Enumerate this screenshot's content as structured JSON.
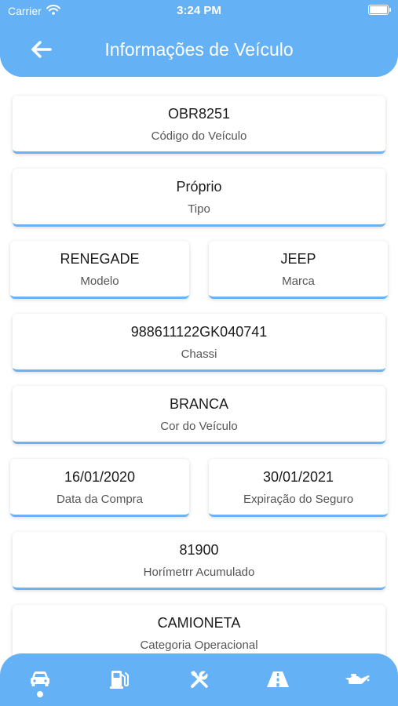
{
  "status": {
    "carrier": "Carrier",
    "time": "3:24 PM"
  },
  "header": {
    "title": "Informações de Veículo"
  },
  "cards": [
    {
      "value": "OBR8251",
      "label": "Código do Veículo"
    },
    {
      "value": "Próprio",
      "label": "Tipo"
    },
    {
      "value": "RENEGADE",
      "label": "Modelo"
    },
    {
      "value": "JEEP",
      "label": "Marca"
    },
    {
      "value": "988611122GK040741",
      "label": "Chassi"
    },
    {
      "value": "BRANCA",
      "label": "Cor do Veículo"
    },
    {
      "value": "16/01/2020",
      "label": "Data da Compra"
    },
    {
      "value": "30/01/2021",
      "label": "Expiração do Seguro"
    },
    {
      "value": "81900",
      "label": "Horímetrr Acumulado"
    },
    {
      "value": "CAMIONETA",
      "label": "Categoria Operacional"
    }
  ],
  "tabs": [
    {
      "icon": "car-icon",
      "active": true
    },
    {
      "icon": "fuel-pump-icon",
      "active": false
    },
    {
      "icon": "tools-icon",
      "active": false
    },
    {
      "icon": "road-icon",
      "active": false
    },
    {
      "icon": "oil-can-icon",
      "active": false
    }
  ],
  "colors": {
    "accent": "#64b1f6",
    "card_underline": "#6ab2f5"
  }
}
